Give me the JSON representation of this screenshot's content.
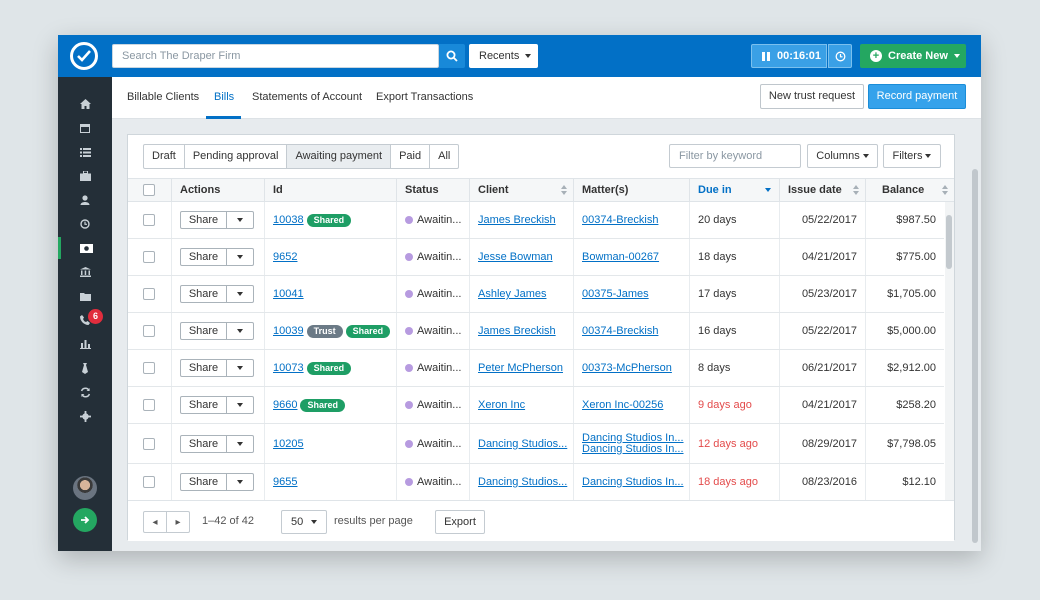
{
  "topbar": {
    "search_placeholder": "Search The Draper Firm",
    "recents_label": "Recents",
    "timer_value": "00:16:01",
    "create_label": "Create New"
  },
  "sidebar": {
    "icons": [
      "home-icon",
      "calendar-icon",
      "tasks-list-icon",
      "briefcase-icon",
      "contacts-icon",
      "clock-icon",
      "billing-icon",
      "bank-icon",
      "folder-icon",
      "phone-icon",
      "reports-icon",
      "tie-icon",
      "sync-icon",
      "settings-icon"
    ],
    "active": "billing-icon",
    "phone_badge": "6"
  },
  "tabs": [
    "Billable Clients",
    "Bills",
    "Statements of Account",
    "Export Transactions"
  ],
  "active_tab": "Bills",
  "actions": {
    "trust_request": "New trust request",
    "record_payment": "Record payment"
  },
  "filter_tabs": [
    "Draft",
    "Pending approval",
    "Awaiting payment",
    "Paid",
    "All"
  ],
  "selected_filter": "Awaiting payment",
  "keyword_placeholder": "Filter by keyword",
  "columns_label": "Columns",
  "filters_label": "Filters",
  "columns": {
    "actions": "Actions",
    "id": "Id",
    "status": "Status",
    "client": "Client",
    "matter": "Matter(s)",
    "due": "Due in",
    "issue": "Issue date",
    "balance": "Balance"
  },
  "share_label": "Share",
  "rows": [
    {
      "id": "10038",
      "tags": [
        "Shared"
      ],
      "status": "Awaitin...",
      "client": "James Breckish",
      "matters": [
        "00374-Breckish"
      ],
      "due": "20 days",
      "overdue": false,
      "issue": "05/22/2017",
      "balance": "$987.50"
    },
    {
      "id": "9652",
      "tags": [],
      "status": "Awaitin...",
      "client": "Jesse Bowman",
      "matters": [
        "Bowman-00267"
      ],
      "due": "18 days",
      "overdue": false,
      "issue": "04/21/2017",
      "balance": "$775.00"
    },
    {
      "id": "10041",
      "tags": [],
      "status": "Awaitin...",
      "client": "Ashley James",
      "matters": [
        "00375-James"
      ],
      "due": "17 days",
      "overdue": false,
      "issue": "05/23/2017",
      "balance": "$1,705.00"
    },
    {
      "id": "10039",
      "tags": [
        "Trust",
        "Shared"
      ],
      "status": "Awaitin...",
      "client": "James Breckish",
      "matters": [
        "00374-Breckish"
      ],
      "due": "16 days",
      "overdue": false,
      "issue": "05/22/2017",
      "balance": "$5,000.00"
    },
    {
      "id": "10073",
      "tags": [
        "Shared"
      ],
      "status": "Awaitin...",
      "client": "Peter McPherson",
      "matters": [
        "00373-McPherson"
      ],
      "due": "8 days",
      "overdue": false,
      "issue": "06/21/2017",
      "balance": "$2,912.00"
    },
    {
      "id": "9660",
      "tags": [
        "Shared"
      ],
      "status": "Awaitin...",
      "client": "Xeron Inc",
      "matters": [
        "Xeron Inc-00256"
      ],
      "due": "9 days ago",
      "overdue": true,
      "issue": "04/21/2017",
      "balance": "$258.20"
    },
    {
      "id": "10205",
      "tags": [],
      "status": "Awaitin...",
      "client": "Dancing Studios...",
      "matters": [
        "Dancing Studios In...",
        "Dancing Studios In..."
      ],
      "due": "12 days ago",
      "overdue": true,
      "issue": "08/29/2017",
      "balance": "$7,798.05"
    },
    {
      "id": "9655",
      "tags": [],
      "status": "Awaitin...",
      "client": "Dancing Studios...",
      "matters": [
        "Dancing Studios In..."
      ],
      "due": "18 days ago",
      "overdue": true,
      "issue": "08/23/2016",
      "balance": "$12.10"
    }
  ],
  "footer": {
    "range": "1–42 of 42",
    "per_page": "50",
    "per_page_label": "results per page",
    "export_label": "Export"
  },
  "colors": {
    "brand": "#0270c6",
    "sidebar": "#242f38",
    "success": "#24a761",
    "overdue": "#e34b4b",
    "status_dot": "#b79be0"
  }
}
